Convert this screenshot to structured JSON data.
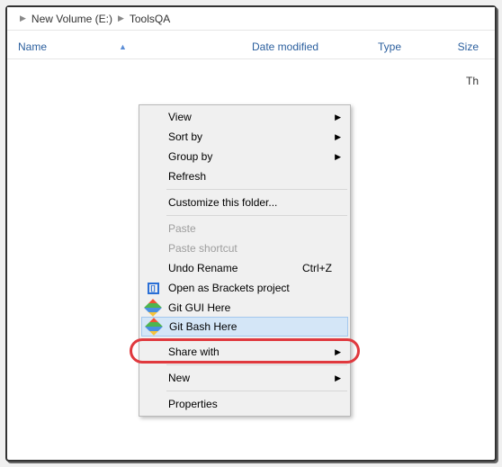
{
  "breadcrumb": {
    "seg1": "New Volume (E:)",
    "seg2": "ToolsQA"
  },
  "columns": {
    "name": "Name",
    "date": "Date modified",
    "type": "Type",
    "size": "Size"
  },
  "empty_text": "Th",
  "menu": {
    "view": "View",
    "sortby": "Sort by",
    "groupby": "Group by",
    "refresh": "Refresh",
    "customize": "Customize this folder...",
    "paste": "Paste",
    "paste_shortcut": "Paste shortcut",
    "undo_rename": "Undo Rename",
    "undo_shortcut": "Ctrl+Z",
    "brackets": "Open as Brackets project",
    "git_gui": "Git GUI Here",
    "git_bash": "Git Bash Here",
    "share": "Share with",
    "new": "New",
    "properties": "Properties"
  }
}
